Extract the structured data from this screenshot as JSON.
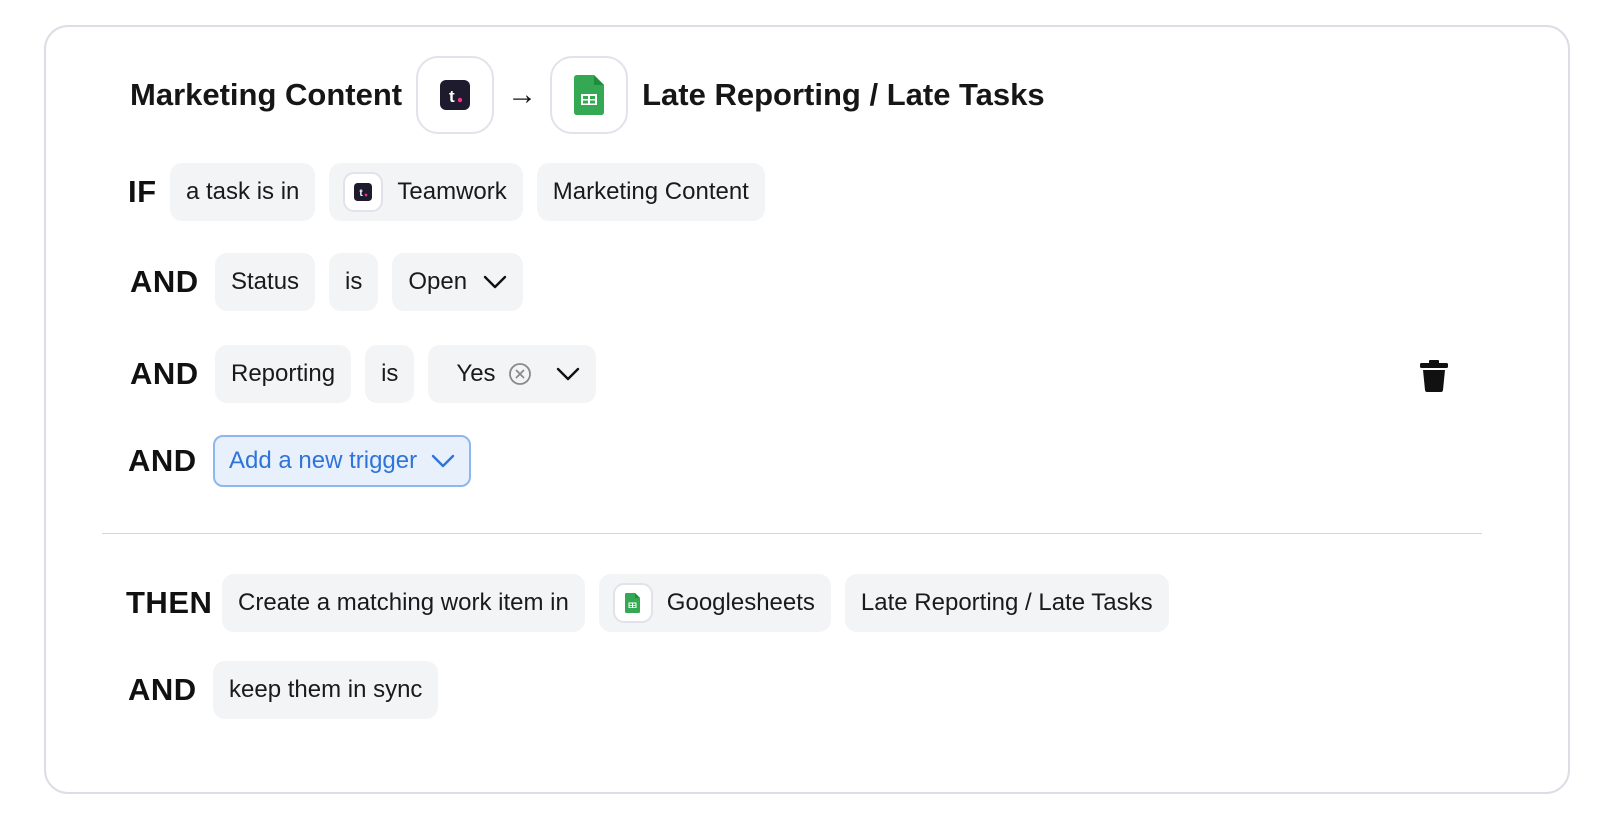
{
  "header": {
    "source_title": "Marketing Content",
    "arrow": "→",
    "dest_title": "Late Reporting / Late Tasks"
  },
  "if_row": {
    "keyword": "IF",
    "condition": "a task is in",
    "app": "Teamwork",
    "project": "Marketing Content"
  },
  "status_row": {
    "keyword": "AND",
    "field": "Status",
    "operator": "is",
    "value": "Open"
  },
  "reporting_row": {
    "keyword": "AND",
    "field": "Reporting",
    "operator": "is",
    "value": "Yes"
  },
  "add_row": {
    "keyword": "AND",
    "button": "Add a new trigger"
  },
  "then_row": {
    "keyword": "THEN",
    "action": "Create a matching work item in",
    "app": "Googlesheets",
    "target": "Late Reporting / Late Tasks"
  },
  "sync_row": {
    "keyword": "AND",
    "action": "keep them in sync"
  },
  "icons": {
    "source_app": "teamwork-icon",
    "dest_app": "google-sheets-icon",
    "delete": "trash-icon",
    "dropdown": "chevron-down-icon",
    "clear": "clear-circle-icon"
  },
  "colors": {
    "accent": "#2f74d8",
    "teamwork_dark": "#1e1b2e",
    "teamwork_dot": "#ff2d8a",
    "sheets_green": "#34a853"
  }
}
